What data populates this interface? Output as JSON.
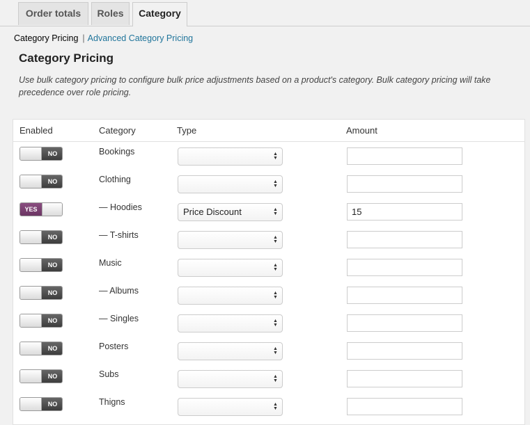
{
  "tabs": [
    {
      "label": "Order totals"
    },
    {
      "label": "Roles"
    },
    {
      "label": "Category"
    }
  ],
  "subnav": {
    "current": "Category Pricing",
    "separator": "|",
    "link": "Advanced Category Pricing"
  },
  "section": {
    "title": "Category Pricing",
    "description": "Use bulk category pricing to configure bulk price adjustments based on a product's category. Bulk category pricing will take precedence over role pricing."
  },
  "table": {
    "headers": {
      "enabled": "Enabled",
      "category": "Category",
      "type": "Type",
      "amount": "Amount"
    },
    "rows": [
      {
        "enabled": "NO",
        "category": "Bookings",
        "type": "",
        "amount": ""
      },
      {
        "enabled": "NO",
        "category": "Clothing",
        "type": "",
        "amount": ""
      },
      {
        "enabled": "YES",
        "category": "— Hoodies",
        "type": "Price Discount",
        "amount": "15"
      },
      {
        "enabled": "NO",
        "category": "— T-shirts",
        "type": "",
        "amount": ""
      },
      {
        "enabled": "NO",
        "category": "Music",
        "type": "",
        "amount": ""
      },
      {
        "enabled": "NO",
        "category": "— Albums",
        "type": "",
        "amount": ""
      },
      {
        "enabled": "NO",
        "category": "— Singles",
        "type": "",
        "amount": ""
      },
      {
        "enabled": "NO",
        "category": "Posters",
        "type": "",
        "amount": ""
      },
      {
        "enabled": "NO",
        "category": "Subs",
        "type": "",
        "amount": ""
      },
      {
        "enabled": "NO",
        "category": "Thigns",
        "type": "",
        "amount": ""
      }
    ]
  },
  "colors": {
    "toggle_on": "#6b3563",
    "toggle_off": "#4a4a4a",
    "link": "#21759b"
  }
}
